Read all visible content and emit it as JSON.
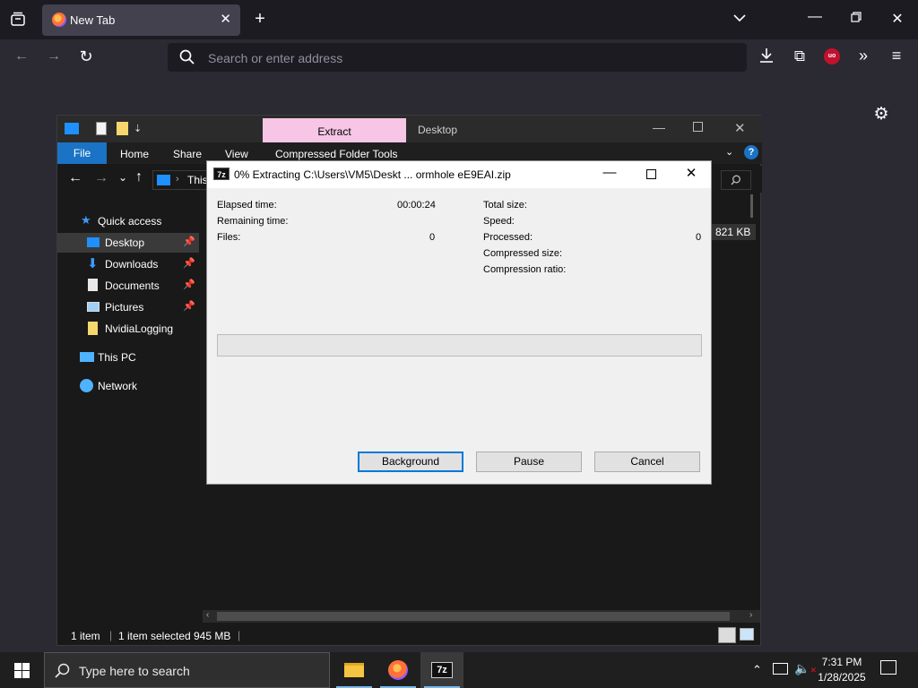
{
  "browser": {
    "tab_title": "New Tab",
    "url_placeholder": "Search or enter address"
  },
  "explorer": {
    "title_tab_active": "Extract",
    "title_tab": "Desktop",
    "ribbon": [
      "File",
      "Home",
      "Share",
      "View",
      "Compressed Folder Tools"
    ],
    "breadcrumb": "This",
    "sidebar": [
      {
        "label": "Quick access",
        "icon": "star-icon",
        "pinned": false
      },
      {
        "label": "Desktop",
        "icon": "desktop-folder-icon",
        "pinned": true
      },
      {
        "label": "Downloads",
        "icon": "downloads-icon",
        "pinned": true
      },
      {
        "label": "Documents",
        "icon": "documents-icon",
        "pinned": true
      },
      {
        "label": "Pictures",
        "icon": "pictures-icon",
        "pinned": true
      },
      {
        "label": "NvidiaLogging",
        "icon": "folder-icon",
        "pinned": false
      },
      {
        "label": "This PC",
        "icon": "computer-icon",
        "pinned": false
      },
      {
        "label": "Network",
        "icon": "network-icon",
        "pinned": false
      }
    ],
    "size_cell": "821 KB",
    "status": {
      "items": "1 item",
      "selected": "1 item selected",
      "selected_size": "945 MB"
    }
  },
  "dialog": {
    "title": "0% Extracting C:\\Users\\VM5\\Deskt ... ormhole eE9EAI.zip",
    "left_fields": [
      {
        "label": "Elapsed time:",
        "value": "00:00:24"
      },
      {
        "label": "Remaining time:",
        "value": ""
      },
      {
        "label": "Files:",
        "value": "0"
      }
    ],
    "right_fields": [
      {
        "label": "Total size:",
        "value": ""
      },
      {
        "label": "Speed:",
        "value": ""
      },
      {
        "label": "Processed:",
        "value": "0"
      },
      {
        "label": "Compressed size:",
        "value": ""
      },
      {
        "label": "Compression ratio:",
        "value": ""
      }
    ],
    "progress": 0,
    "buttons": {
      "background": "Background",
      "pause": "Pause",
      "cancel": "Cancel"
    }
  },
  "taskbar": {
    "search_placeholder": "Type here to search",
    "time": "7:31 PM",
    "date": "1/28/2025"
  }
}
